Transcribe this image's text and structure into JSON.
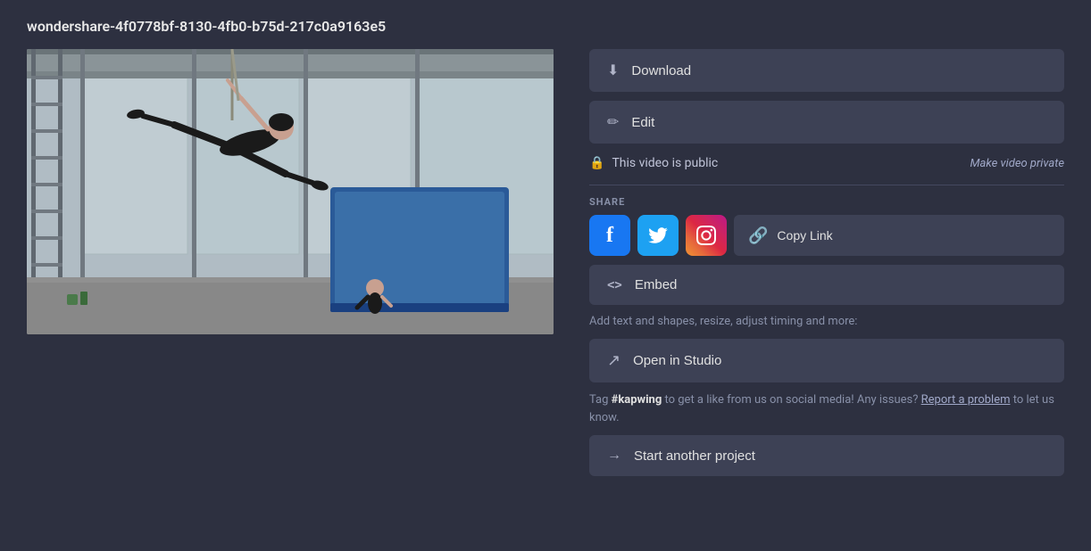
{
  "title": "wondershare-4f0778bf-8130-4fb0-b75d-217c0a9163e5",
  "buttons": {
    "download": "Download",
    "edit": "Edit",
    "copy_link": "Copy Link",
    "embed": "Embed",
    "open_studio": "Open in Studio",
    "start_project": "Start another project",
    "make_private": "Make video private"
  },
  "status": {
    "visibility": "This video is public"
  },
  "share_label": "SHARE",
  "studio_hint": "Add text and shapes, resize, adjust timing and more:",
  "tag_text_before": "Tag ",
  "tag_keyword": "#kapwing",
  "tag_text_middle": " to get a like from us on social media! Any issues?",
  "tag_report": "Report a problem",
  "tag_text_after": " to let us know.",
  "icons": {
    "download": "⬇",
    "edit": "✏",
    "lock": "🔒",
    "copy_link": "🔗",
    "embed": "<>",
    "open_studio": "↗",
    "arrow_right": "→",
    "facebook": "f",
    "twitter": "t"
  },
  "colors": {
    "bg": "#2d3040",
    "btn_bg": "#3d4155",
    "facebook": "#1877f2",
    "twitter": "#1da1f2"
  }
}
